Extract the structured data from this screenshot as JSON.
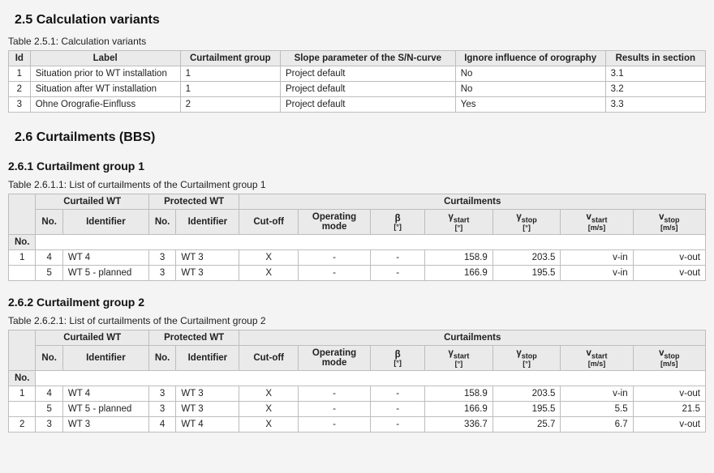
{
  "section25": {
    "heading": "2.5 Calculation variants",
    "caption": "Table 2.5.1: Calculation variants",
    "headers": [
      "Id",
      "Label",
      "Curtailment group",
      "Slope parameter of the S/N-curve",
      "Ignore influence of orography",
      "Results in section"
    ],
    "rows": [
      {
        "id": "1",
        "label": "Situation prior to WT installation",
        "group": "1",
        "slope": "Project default",
        "ignore": "No",
        "results": "3.1"
      },
      {
        "id": "2",
        "label": "Situation after WT installation",
        "group": "1",
        "slope": "Project default",
        "ignore": "No",
        "results": "3.2"
      },
      {
        "id": "3",
        "label": "Ohne Orografie-Einfluss",
        "group": "2",
        "slope": "Project default",
        "ignore": "Yes",
        "results": "3.3"
      }
    ]
  },
  "section26": {
    "heading": "2.6 Curtailments (BBS)",
    "group_hdr": {
      "curtailed": "Curtailed WT",
      "protected": "Protected WT",
      "curtailments": "Curtailments",
      "no": "No.",
      "identifier": "Identifier",
      "cutoff": "Cut-off",
      "opmode": "Operating mode",
      "beta": "β",
      "beta_unit": "[°]",
      "gstart": "γstart",
      "gstart_unit": "[°]",
      "gstop": "γstop",
      "gstop_unit": "[°]",
      "vstart": "vstart",
      "vstart_unit": "[m/s]",
      "vstop": "vstop",
      "vstop_unit": "[m/s]"
    },
    "group1": {
      "heading": "2.6.1 Curtailment group 1",
      "caption": "Table 2.6.1.1: List of curtailments of the Curtailment group 1",
      "rows": [
        {
          "row_no": "1",
          "c_no": "4",
          "c_id": "WT 4",
          "p_no": "3",
          "p_id": "WT 3",
          "cutoff": "X",
          "opmode": "-",
          "beta": "-",
          "gstart": "158.9",
          "gstop": "203.5",
          "vstart": "v-in",
          "vstop": "v-out"
        },
        {
          "row_no": "",
          "c_no": "5",
          "c_id": "WT 5 - planned",
          "p_no": "3",
          "p_id": "WT 3",
          "cutoff": "X",
          "opmode": "-",
          "beta": "-",
          "gstart": "166.9",
          "gstop": "195.5",
          "vstart": "v-in",
          "vstop": "v-out"
        }
      ]
    },
    "group2": {
      "heading": "2.6.2 Curtailment group 2",
      "caption": "Table 2.6.2.1: List of curtailments of the Curtailment group 2",
      "rows": [
        {
          "row_no": "1",
          "c_no": "4",
          "c_id": "WT 4",
          "p_no": "3",
          "p_id": "WT 3",
          "cutoff": "X",
          "opmode": "-",
          "beta": "-",
          "gstart": "158.9",
          "gstop": "203.5",
          "vstart": "v-in",
          "vstop": "v-out"
        },
        {
          "row_no": "",
          "c_no": "5",
          "c_id": "WT 5 - planned",
          "p_no": "3",
          "p_id": "WT 3",
          "cutoff": "X",
          "opmode": "-",
          "beta": "-",
          "gstart": "166.9",
          "gstop": "195.5",
          "vstart": "5.5",
          "vstop": "21.5"
        },
        {
          "row_no": "2",
          "c_no": "3",
          "c_id": "WT 3",
          "p_no": "4",
          "p_id": "WT 4",
          "cutoff": "X",
          "opmode": "-",
          "beta": "-",
          "gstart": "336.7",
          "gstop": "25.7",
          "vstart": "6.7",
          "vstop": "v-out"
        }
      ]
    }
  }
}
